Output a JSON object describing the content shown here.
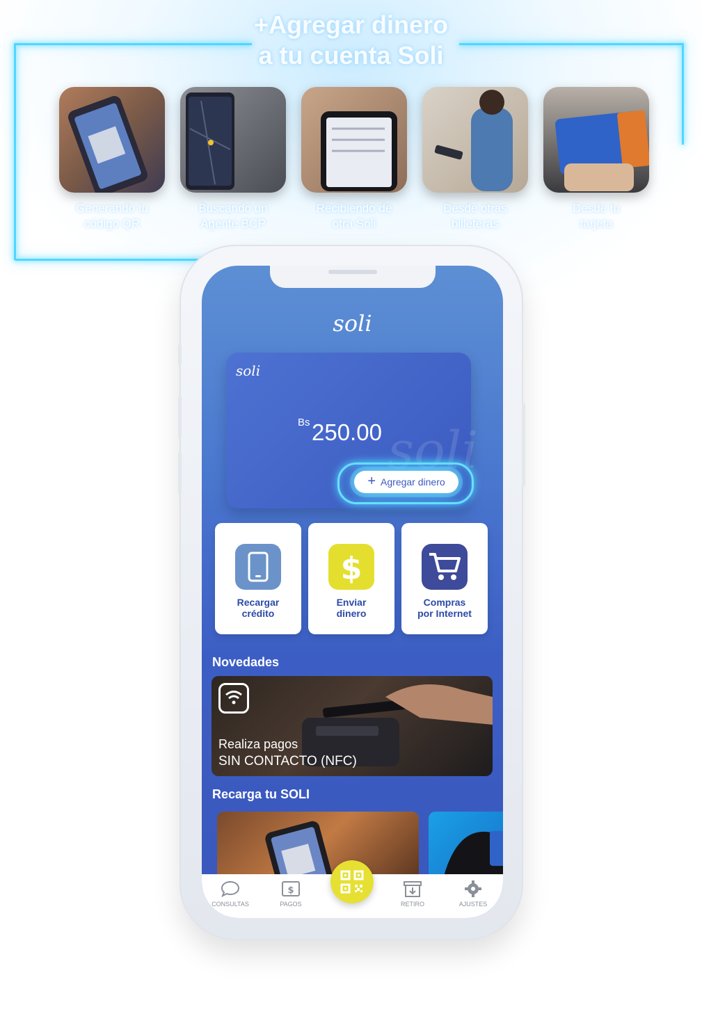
{
  "headline": {
    "line1": "+Agregar dinero",
    "line2": "a tu cuenta Soli"
  },
  "options": [
    {
      "label_line1": "Generando tu",
      "label_line2": "código QR"
    },
    {
      "label_line1": "Buscando un",
      "label_line2": "Agente BCP"
    },
    {
      "label_line1": "Recibiendo de",
      "label_line2": "otra Soli"
    },
    {
      "label_line1": "Desde otras",
      "label_line2": "billeteras"
    },
    {
      "label_line1": "Desde tu",
      "label_line2": "tarjeta"
    }
  ],
  "app": {
    "logo": "soli",
    "card": {
      "logo": "soli",
      "watermark": "soli",
      "currency": "Bs",
      "amount": "250.00",
      "add_label": "Agregar dinero"
    },
    "actions": [
      {
        "label": "Recargar\ncrédito",
        "icon": "phone-icon",
        "color": "#6b93c9"
      },
      {
        "label": "Enviar\ndinero",
        "icon": "dollar-icon",
        "color": "#e4df2f"
      },
      {
        "label": "Compras\npor Internet",
        "icon": "cart-icon",
        "color": "#3e4a9a"
      }
    ],
    "novedades": {
      "title": "Novedades",
      "line1": "Realiza pagos",
      "line2_bold": "SIN CONTACTO",
      "line2_rest": " (NFC)"
    },
    "recarga": {
      "title": "Recarga tu SOLI"
    },
    "tabs": {
      "consultas": "CONSULTAS",
      "pagos": "PAGOS",
      "retiro": "RETIRO",
      "ajustes": "AJUSTES"
    }
  },
  "colors": {
    "neon": "#4fd8ff",
    "brand_blue": "#3b5ac0",
    "accent_yellow": "#e6e033"
  }
}
